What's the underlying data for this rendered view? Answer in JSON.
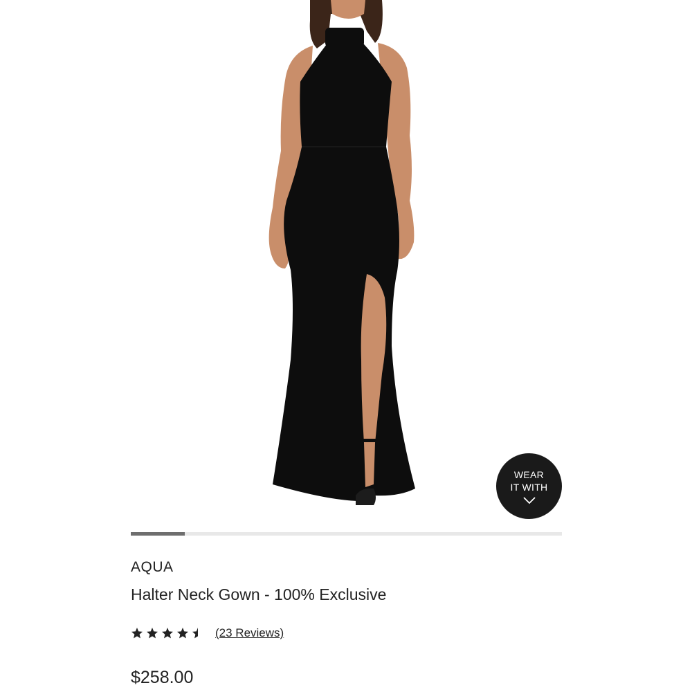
{
  "product": {
    "brand": "AQUA",
    "title": "Halter Neck Gown - 100% Exclusive",
    "price": "$258.00",
    "image_alt": "Model wearing black halter neck gown with front slit"
  },
  "rating": {
    "stars": 4.5,
    "max_stars": 5,
    "reviews_label": "(23 Reviews)"
  },
  "wear_it_with": {
    "line1": "WEAR",
    "line2": "IT WITH",
    "icon": "chevron-down-icon"
  },
  "carousel": {
    "progress": 0.125
  },
  "colors": {
    "dress": "#0d0d0d",
    "skin": "#c98e6a",
    "button_bg": "#1a1a1a",
    "track": "#e8e8e8",
    "progress": "#6e6e6e",
    "text": "#222222"
  }
}
